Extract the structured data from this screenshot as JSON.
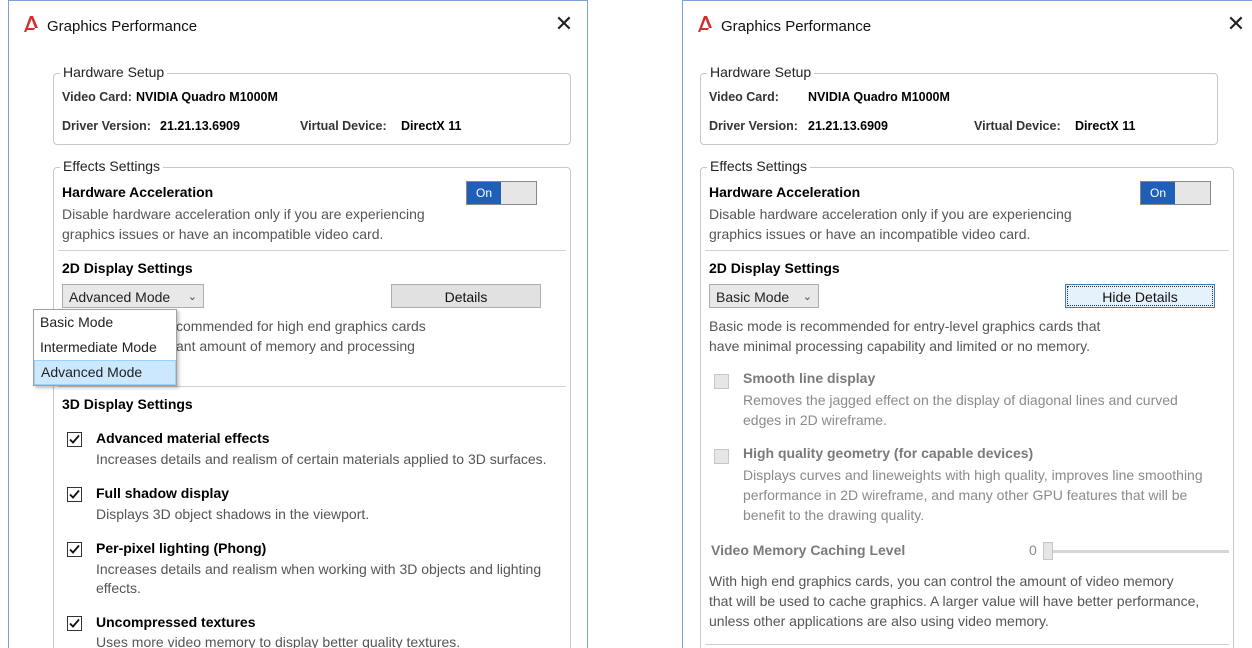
{
  "left_window": {
    "title": "Graphics Performance",
    "hardware": {
      "legend": "Hardware Setup",
      "video_card_label": "Video Card:",
      "video_card_value": "NVIDIA Quadro M1000M",
      "driver_label": "Driver Version:",
      "driver_value": "21.21.13.6909",
      "virtual_label": "Virtual Device:",
      "virtual_value": "DirectX 11"
    },
    "effects": {
      "legend": "Effects Settings",
      "hw_accel_title": "Hardware Acceleration",
      "hw_accel_desc1": "Disable hardware acceleration only if you are experiencing",
      "hw_accel_desc2": "graphics issues or have an incompatible video card.",
      "toggle_label": "On",
      "display2d_title": "2D Display Settings",
      "mode_selected": "Advanced Mode",
      "details_button": "Details",
      "partial_desc1": "commended for high end graphics cards",
      "partial_desc2": "ant amount of memory and processing",
      "dropdown_options": [
        "Basic Mode",
        "Intermediate Mode",
        "Advanced Mode"
      ],
      "display3d_title": "3D Display Settings",
      "options3d": [
        {
          "title": "Advanced material effects",
          "desc1": "Increases details and realism of certain materials applied to 3D surfaces.",
          "desc2": "",
          "checked": true
        },
        {
          "title": "Full shadow display",
          "desc1": "Displays 3D object shadows in the viewport.",
          "desc2": "",
          "checked": true
        },
        {
          "title": "Per-pixel lighting (Phong)",
          "desc1": "Increases details and realism when working with 3D objects and lighting",
          "desc2": "effects.",
          "checked": true
        },
        {
          "title": "Uncompressed textures",
          "desc1": "Uses more video memory to display better quality textures.",
          "desc2": "",
          "checked": true
        }
      ]
    }
  },
  "right_window": {
    "title": "Graphics Performance",
    "hardware": {
      "legend": "Hardware Setup",
      "video_card_label": "Video Card:",
      "video_card_value": "NVIDIA Quadro M1000M",
      "driver_label": "Driver Version:",
      "driver_value": "21.21.13.6909",
      "virtual_label": "Virtual Device:",
      "virtual_value": "DirectX 11"
    },
    "effects": {
      "legend": "Effects Settings",
      "hw_accel_title": "Hardware Acceleration",
      "hw_accel_desc1": "Disable hardware acceleration only if you are experiencing",
      "hw_accel_desc2": "graphics issues or have an incompatible video card.",
      "toggle_label": "On",
      "display2d_title": "2D Display Settings",
      "mode_selected": "Basic Mode",
      "hide_details_button": "Hide Details",
      "basic_desc1": "Basic mode is recommended for entry-level graphics cards that",
      "basic_desc2": "have minimal processing capability and limited or no memory.",
      "smooth_title": "Smooth line display",
      "smooth_desc1": "Removes the jagged effect on the display of diagonal lines and curved",
      "smooth_desc2": "edges in 2D wireframe.",
      "hq_title": "High quality geometry (for capable devices)",
      "hq_desc1": "Displays curves and lineweights with high quality, improves line smoothing",
      "hq_desc2": "performance in 2D wireframe, and many other GPU features that will be",
      "hq_desc3": "benefit to the drawing quality.",
      "vmc_title": "Video Memory Caching Level",
      "vmc_value": "0",
      "vmc_desc1": "With high end graphics cards, you can control the amount of video memory",
      "vmc_desc2": "that will be used to cache graphics.  A larger value will have better performance,",
      "vmc_desc3": "unless other applications are also using video memory."
    }
  },
  "colors": {
    "accent": "#1f5fb8",
    "dropdown_selected": "#cce8ff",
    "app_icon": "#d32f2f"
  },
  "icons": {
    "app": "autocad-logo-icon",
    "close": "close-icon",
    "check": "checkmark-icon",
    "chevron": "chevron-down-icon"
  }
}
